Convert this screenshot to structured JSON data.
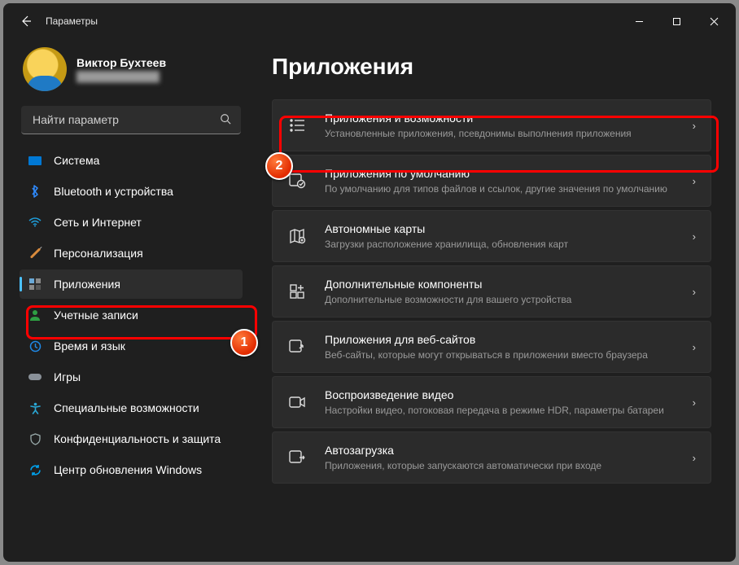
{
  "window": {
    "title": "Параметры"
  },
  "profile": {
    "name": "Виктор Бухтеев",
    "email_obscured": "████████████"
  },
  "search": {
    "placeholder": "Найти параметр"
  },
  "nav": {
    "items": [
      {
        "label": "Система"
      },
      {
        "label": "Bluetooth и устройства"
      },
      {
        "label": "Сеть и Интернет"
      },
      {
        "label": "Персонализация"
      },
      {
        "label": "Приложения"
      },
      {
        "label": "Учетные записи"
      },
      {
        "label": "Время и язык"
      },
      {
        "label": "Игры"
      },
      {
        "label": "Специальные возможности"
      },
      {
        "label": "Конфиденциальность и защита"
      },
      {
        "label": "Центр обновления Windows"
      }
    ],
    "selected_index": 4
  },
  "page": {
    "title": "Приложения",
    "cards": [
      {
        "title": "Приложения и возможности",
        "sub": "Установленные приложения, псевдонимы выполнения приложения"
      },
      {
        "title": "Приложения по умолчанию",
        "sub": "По умолчанию для типов файлов и ссылок, другие значения по умолчанию"
      },
      {
        "title": "Автономные карты",
        "sub": "Загрузки расположение хранилища, обновления карт"
      },
      {
        "title": "Дополнительные компоненты",
        "sub": "Дополнительные возможности для вашего устройства"
      },
      {
        "title": "Приложения для веб-сайтов",
        "sub": "Веб-сайты, которые могут открываться в приложении вместо браузера"
      },
      {
        "title": "Воспроизведение видео",
        "sub": "Настройки видео, потоковая передача в режиме HDR, параметры батареи"
      },
      {
        "title": "Автозагрузка",
        "sub": "Приложения, которые запускаются автоматически при входе"
      }
    ]
  },
  "annotations": {
    "badge1": "1",
    "badge2": "2"
  }
}
